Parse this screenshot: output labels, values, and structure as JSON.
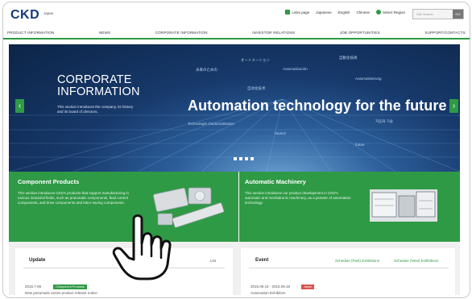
{
  "header": {
    "logo": "CKD",
    "region": "Japan",
    "links": [
      "Links page",
      "Japanese",
      "English",
      "Chinese",
      "Select Region"
    ],
    "search_placeholder": "Site Search",
    "search_button": "GO"
  },
  "nav": [
    "PRODUCT INFORMATION",
    "NEWS",
    "CORPORATE INFORMATION",
    "INVESTOR RELATIONS",
    "JOB OPPORTUNITIES",
    "SUPPORT/CONTACTS"
  ],
  "hero": {
    "title_line1": "CORPORATE",
    "title_line2": "INFORMATION",
    "description": "This section introduces the company, its history and its board of directors.",
    "tagline": "Automation technology for the future",
    "floating": [
      "オートメーション",
      "自動化技術",
      "未来のための",
      "Automatización",
      "Automatisierung",
      "自动化技术",
      "자동화 기술",
      "Technologie d'automatisation",
      "l'avenir",
      "future"
    ],
    "prev_arrow": "‹",
    "next_arrow": "›",
    "dot_count": 4,
    "accent": "#2f9a45"
  },
  "panels": {
    "component": {
      "title": "Component Products",
      "description": "This section introduces CKD's products that support manufacturing in various industrial fields, such as pneumatic components, fluid control components, and drive components and labor-saving components."
    },
    "machinery": {
      "title": "Automatic Machinery",
      "description": "This section introduces our product development in CKD's automatic and mechatronic machinery, as a pioneer of automation technology."
    }
  },
  "update": {
    "title": "Update",
    "list_link": "List",
    "date": "2015.7.08",
    "badge": "Component Products",
    "item_text": "New pneumatic series product release notice"
  },
  "event": {
    "title": "Event",
    "link1": "Schedule (Past) Exhibitions",
    "link2": "Schedule (Next) Exhibitions",
    "date": "2015.09.15 - 2015.09.18",
    "badge": "Japan",
    "item_text": "Automation Exhibition"
  }
}
